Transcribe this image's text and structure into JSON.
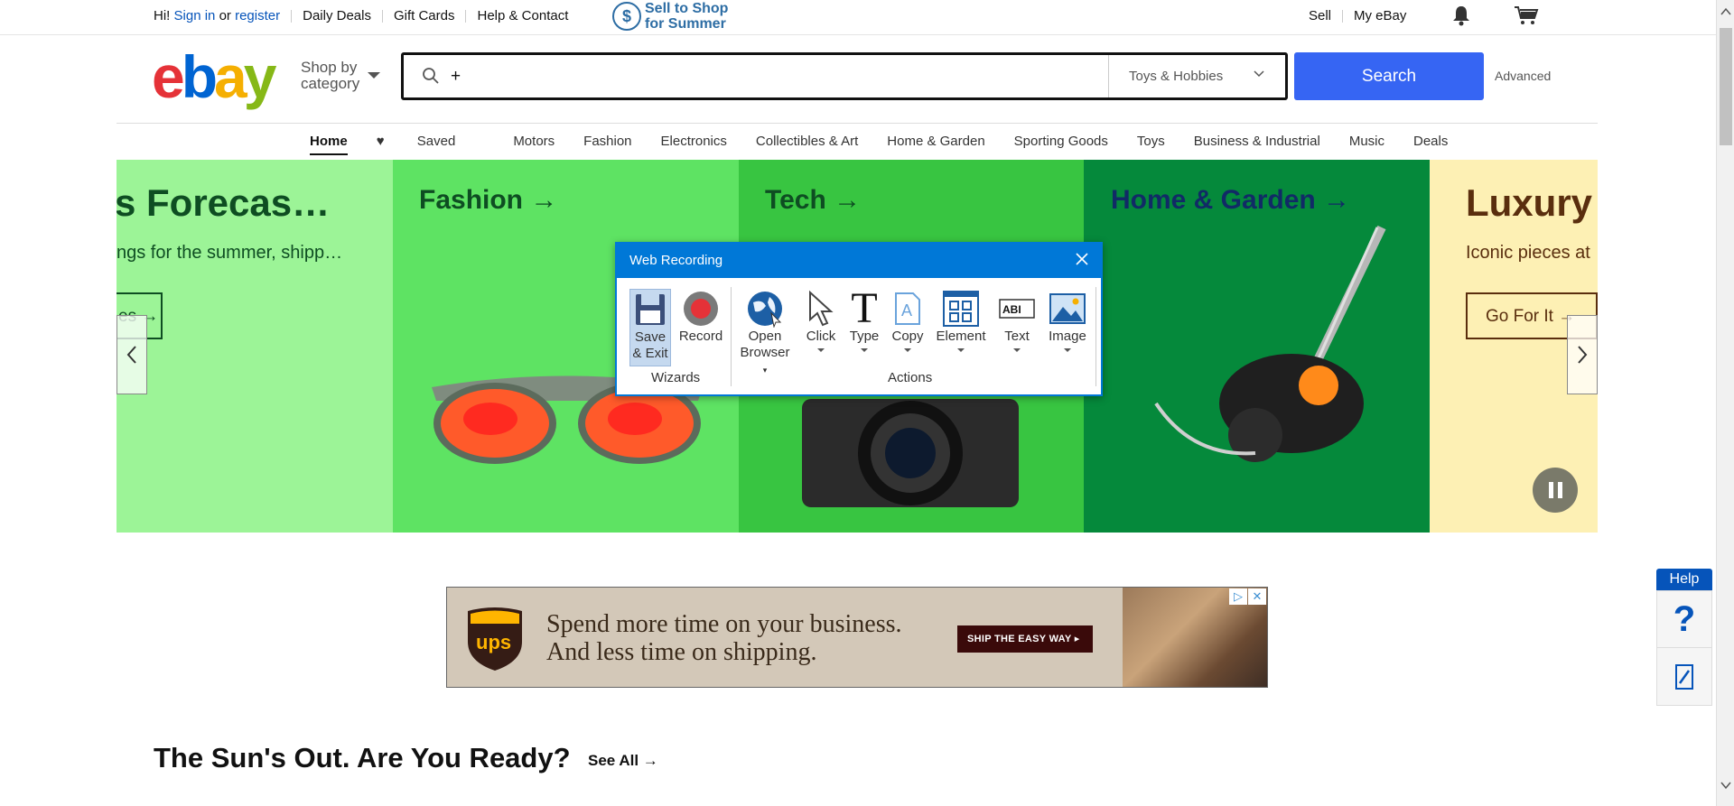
{
  "topbar": {
    "greeting": "Hi!",
    "sign_in": "Sign in",
    "or": "or",
    "register": "register",
    "links": [
      "Daily Deals",
      "Gift Cards",
      "Help & Contact"
    ],
    "promo_line1": "Sell to Shop",
    "promo_line2": "for Summer",
    "promo_icon": "$",
    "sell": "Sell",
    "my_ebay": "My eBay"
  },
  "header": {
    "logo": [
      "e",
      "b",
      "a",
      "y"
    ],
    "shop_by_line1": "Shop by",
    "shop_by_line2": "category",
    "search_value": "+",
    "category_select": "Toys & Hobbies",
    "search_button": "Search",
    "advanced": "Advanced"
  },
  "nav": [
    "Home",
    "Saved",
    "Motors",
    "Fashion",
    "Electronics",
    "Collectibles & Art",
    "Home & Garden",
    "Sporting Goods",
    "Toys",
    "Business & Industrial",
    "Music",
    "Deals"
  ],
  "carousel": {
    "panel1_title": "s Forecas…",
    "panel1_sub": "ngs for the summer, shipp…",
    "panel1_btn": "es",
    "panel2_title": "Fashion",
    "panel3_title": "Tech",
    "panel4_title": "Home & Garden",
    "panel5_title": "Luxury",
    "panel5_sub": "Iconic pieces at",
    "panel5_btn": "Go For It",
    "colors": {
      "p1": "#9cf497",
      "p2": "#5ee363",
      "p3": "#38c541",
      "p4": "#05893b",
      "p5": "#fdf0b4"
    }
  },
  "dialog": {
    "title": "Web Recording",
    "tools": {
      "save_line1": "Save",
      "save_line2": "& Exit",
      "record": "Record",
      "open_line1": "Open",
      "open_line2": "Browser",
      "click": "Click",
      "type": "Type",
      "copy": "Copy",
      "element": "Element",
      "text": "Text",
      "image": "Image"
    },
    "groups": {
      "wizards": "Wizards",
      "actions": "Actions"
    }
  },
  "ad": {
    "brand": "ups",
    "line1": "Spend more time on your business.",
    "line2": "And less time on shipping.",
    "cta": "SHIP THE EASY WAY ▸"
  },
  "section": {
    "title": "The Sun's Out. Are You Ready?",
    "see_all": "See All"
  },
  "help": {
    "label": "Help",
    "question": "?"
  }
}
